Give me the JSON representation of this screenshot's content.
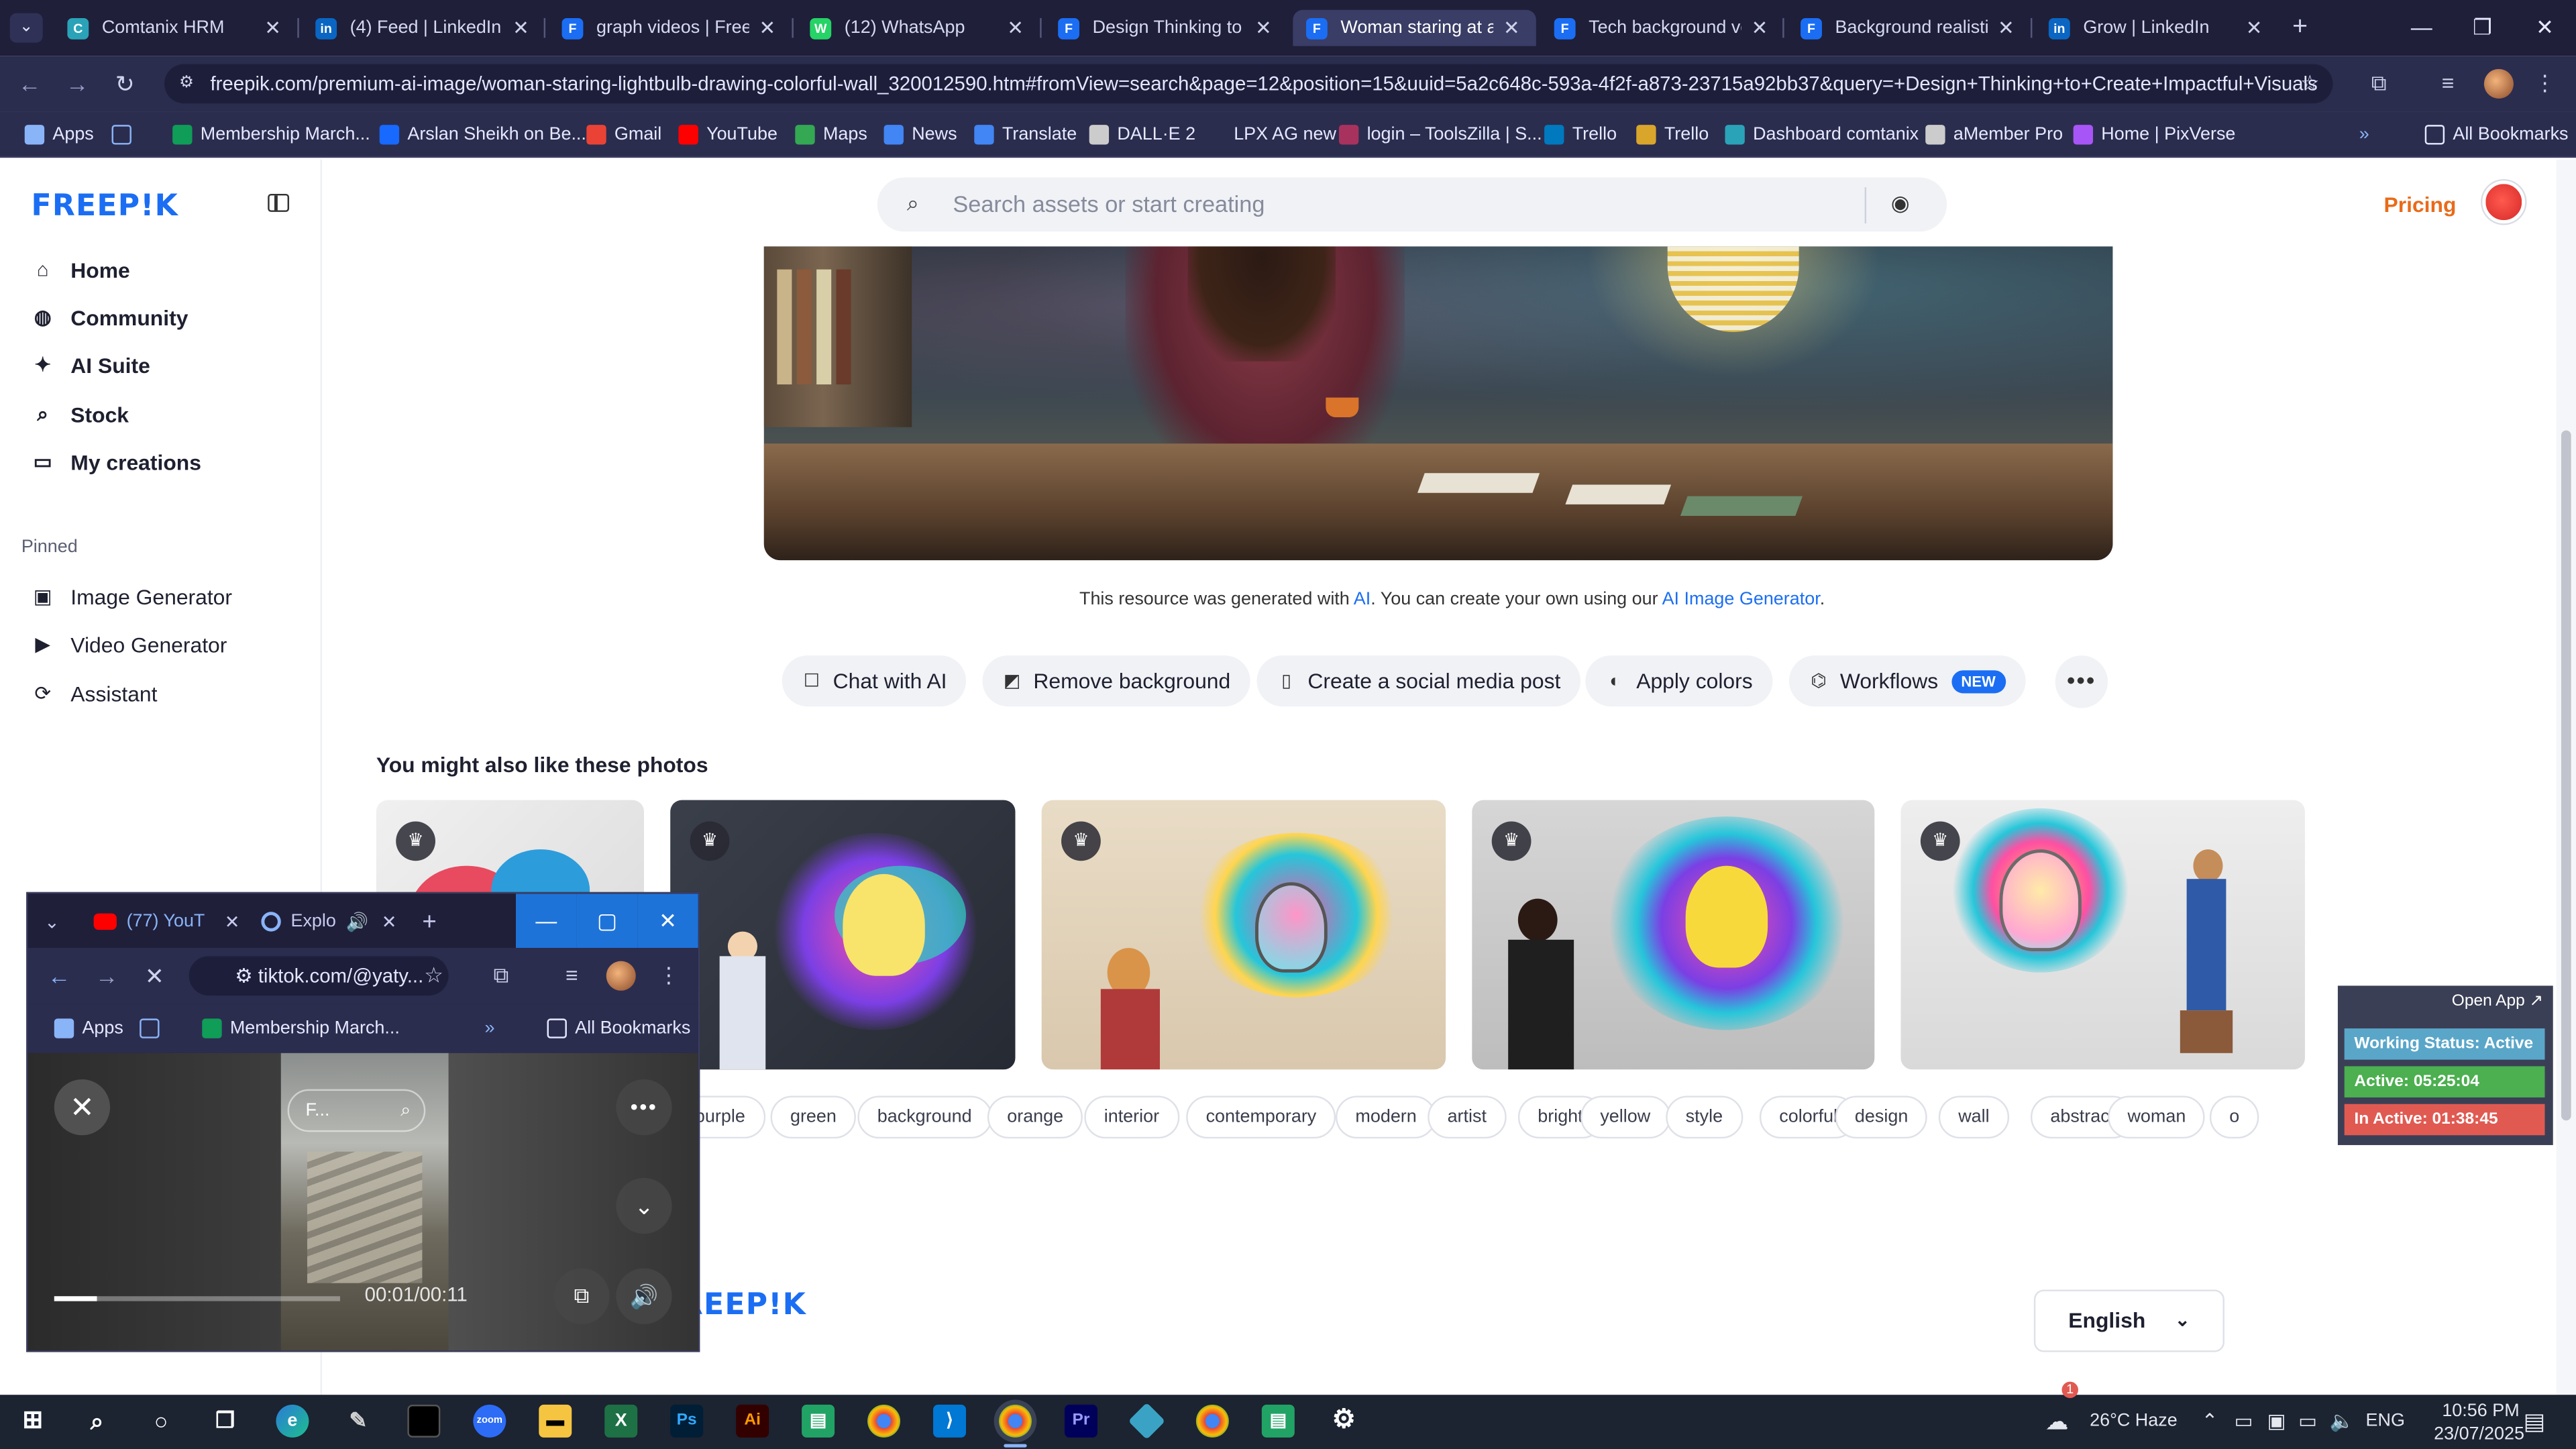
{
  "browser": {
    "tabs": [
      {
        "label": "Comtanix HRM",
        "icon": "comtanix-icon",
        "color": "#2aa3b8",
        "glyph": "C"
      },
      {
        "label": "(4) Feed | LinkedIn",
        "icon": "linkedin-icon",
        "color": "#0a66c2",
        "glyph": "in"
      },
      {
        "label": "graph videos | Freepi",
        "icon": "freepik-icon",
        "color": "#1b6ef3",
        "glyph": "F"
      },
      {
        "label": "(12) WhatsApp",
        "icon": "whatsapp-icon",
        "color": "#25d366",
        "glyph": "W"
      },
      {
        "label": "Design Thinking to C",
        "icon": "freepik-icon",
        "color": "#1b6ef3",
        "glyph": "F"
      },
      {
        "label": "Woman staring at a l",
        "icon": "freepik-icon",
        "color": "#1b6ef3",
        "glyph": "F"
      },
      {
        "label": "Tech background vec",
        "icon": "freepik-icon",
        "color": "#1b6ef3",
        "glyph": "F"
      },
      {
        "label": "Background realistic",
        "icon": "freepik-icon",
        "color": "#1b6ef3",
        "glyph": "F"
      },
      {
        "label": "Grow | LinkedIn",
        "icon": "linkedin-icon",
        "color": "#0a66c2",
        "glyph": "in"
      }
    ],
    "active_tab_index": 5,
    "url": "freepik.com/premium-ai-image/woman-staring-lightbulb-drawing-colorful-wall_320012590.htm#fromView=search&page=12&position=15&uuid=5a2c648c-593a-4f2f-a873-23715a92bb37&query=+Design+Thinking+to+Create+Impactful+Visuals",
    "bookmarks": [
      {
        "label": "Apps",
        "icon": "apps-grid-icon",
        "color": "#8ab4f8"
      },
      {
        "label": "",
        "icon": "tab-groups-icon",
        "color": "#8ab4f8"
      },
      {
        "label": "Membership March...",
        "icon": "sheets-icon",
        "color": "#0f9d58"
      },
      {
        "label": "Arslan Sheikh on Be...",
        "icon": "behance-icon",
        "color": "#1769ff"
      },
      {
        "label": "Gmail",
        "icon": "gmail-icon",
        "color": "#ea4335"
      },
      {
        "label": "YouTube",
        "icon": "youtube-icon",
        "color": "#ff0000"
      },
      {
        "label": "Maps",
        "icon": "maps-icon",
        "color": "#34a853"
      },
      {
        "label": "News",
        "icon": "news-icon",
        "color": "#4285f4"
      },
      {
        "label": "Translate",
        "icon": "translate-icon",
        "color": "#4285f4"
      },
      {
        "label": "DALL·E 2",
        "icon": "openai-icon",
        "color": "#cccccc"
      },
      {
        "label": "LPX AG new",
        "icon": "page-icon",
        "color": "#888888"
      },
      {
        "label": "login – ToolsZilla | S...",
        "icon": "toolszilla-icon",
        "color": "#a8325e"
      },
      {
        "label": "Trello",
        "icon": "trello-icon",
        "color": "#0079bf"
      },
      {
        "label": "Trello",
        "icon": "trello-icon",
        "color": "#d9a52b"
      },
      {
        "label": "Dashboard comtanix",
        "icon": "comtanix-icon",
        "color": "#2aa3b8"
      },
      {
        "label": "aMember Pro",
        "icon": "amember-icon",
        "color": "#cccccc"
      },
      {
        "label": "Home | PixVerse",
        "icon": "pixverse-icon",
        "color": "#a855f7"
      }
    ],
    "all_bookmarks": "All Bookmarks"
  },
  "freepik": {
    "logo": "FREEP!K",
    "nav": [
      {
        "label": "Home",
        "icon": "home-icon",
        "glyph": "⌂"
      },
      {
        "label": "Community",
        "icon": "globe-icon",
        "glyph": "◍"
      },
      {
        "label": "AI Suite",
        "icon": "sparkle-icon",
        "glyph": "✦"
      },
      {
        "label": "Stock",
        "icon": "search-icon",
        "glyph": "⌕"
      },
      {
        "label": "My creations",
        "icon": "folder-icon",
        "glyph": "▭"
      }
    ],
    "pinned_heading": "Pinned",
    "pinned": [
      {
        "label": "Image Generator",
        "icon": "image-icon",
        "glyph": "▣"
      },
      {
        "label": "Video Generator",
        "icon": "video-icon",
        "glyph": "▶"
      },
      {
        "label": "Assistant",
        "icon": "assistant-icon",
        "glyph": "⟳"
      }
    ],
    "search_placeholder": "Search assets or start creating",
    "pricing": "Pricing",
    "credit": {
      "prefix": "This resource was generated with ",
      "ai_link": "AI",
      "middle": ". You can create your own using our ",
      "generator_link": "AI Image Generator",
      "suffix": "."
    },
    "actions": [
      {
        "label": "Chat with AI",
        "icon": "chat-icon",
        "glyph": "☐"
      },
      {
        "label": "Remove background",
        "icon": "remove-bg-icon",
        "glyph": "◩"
      },
      {
        "label": "Create a social media post",
        "icon": "phone-icon",
        "glyph": "▯"
      },
      {
        "label": "Apply colors",
        "icon": "palette-icon",
        "glyph": "◐"
      },
      {
        "label": "Workflows",
        "icon": "workflow-icon",
        "glyph": "⌬",
        "badge": "NEW"
      }
    ],
    "more": "•••",
    "related_heading": "You might also like these photos",
    "tags": [
      "purple",
      "green",
      "background",
      "orange",
      "interior",
      "contemporary",
      "modern",
      "artist",
      "bright",
      "yellow",
      "style",
      "colorful",
      "design",
      "wall",
      "abstract",
      "woman",
      "o"
    ],
    "footer_logo": "REEP!K",
    "language": "English"
  },
  "status_widget": {
    "open_app": "Open App ↗",
    "working": "Working Status: Active",
    "active": "Active: 05:25:04",
    "inactive": "In Active: 01:38:45",
    "colors": {
      "working": "#5aa6c9",
      "active": "#4caf50",
      "inactive": "#e05a52"
    }
  },
  "mini_browser": {
    "tabs": [
      {
        "label": "(77) YouT",
        "icon": "youtube-icon"
      },
      {
        "label": "Explo",
        "icon": "tiktok-icon"
      }
    ],
    "url": "tiktok.com/@yaty...",
    "bookmarks": [
      "Apps",
      "Membership March...",
      "All Bookmarks"
    ],
    "video": {
      "overlay_text": "F...",
      "time": "00:01/00:11",
      "progress": 0.15
    }
  },
  "taskbar": {
    "weather": "26°C Haze",
    "weather_badge": "1",
    "language": "ENG",
    "time": "10:56 PM",
    "date": "23/07/2025"
  }
}
